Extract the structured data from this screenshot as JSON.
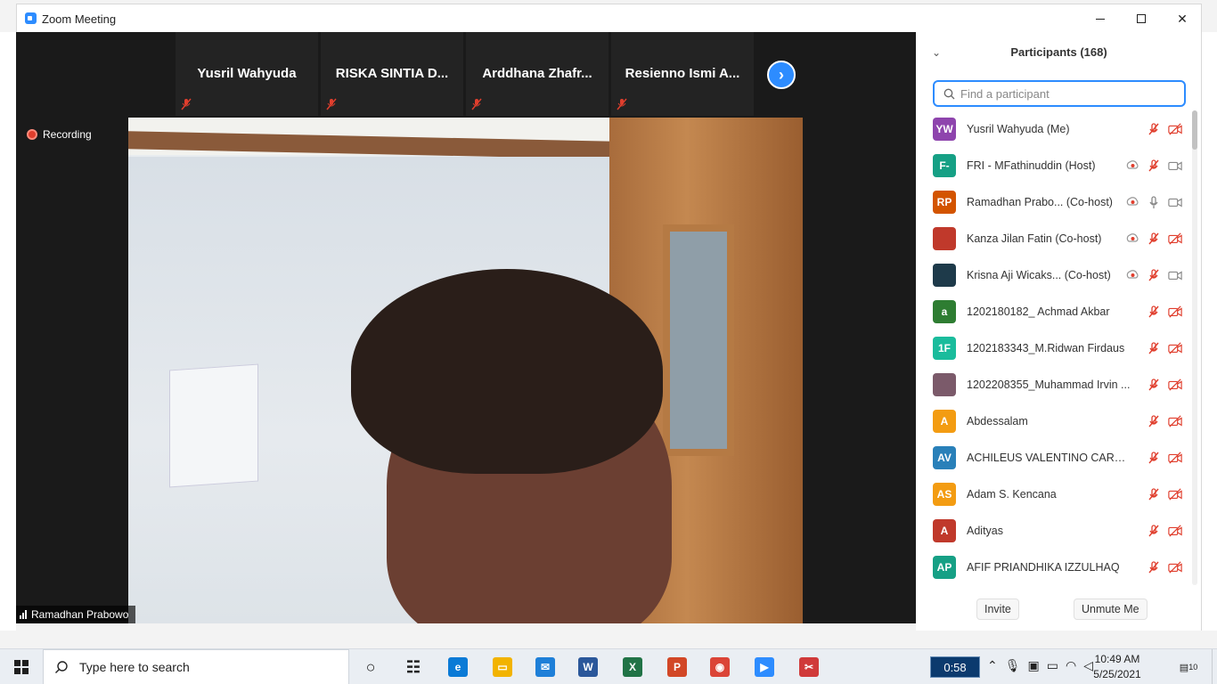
{
  "window": {
    "title": "Zoom Meeting",
    "app_icon": "zoom-icon"
  },
  "video": {
    "recording_label": "Recording",
    "thumbnails": [
      {
        "name": "Yusril Wahyuda"
      },
      {
        "name": "RISKA SINTIA D..."
      },
      {
        "name": "Arddhana Zhafr..."
      },
      {
        "name": "Resienno Ismi A..."
      }
    ],
    "speaker_name": "Ramadhan Prabowo",
    "next_arrow": "›"
  },
  "participants": {
    "title": "Participants (168)",
    "collapse_icon": "chevron-down-icon",
    "search_placeholder": "Find a participant",
    "list": [
      {
        "initials": "YW",
        "name": "Yusril Wahyuda (Me)",
        "color": "#8e44ad",
        "record": false,
        "mic": "muted",
        "video": "off"
      },
      {
        "initials": "F-",
        "name": "FRI - MFathinuddin (Host)",
        "color": "#16a085",
        "record": true,
        "mic": "muted",
        "video": "on"
      },
      {
        "initials": "RP",
        "name": "Ramadhan Prabo...  (Co-host)",
        "color": "#d35400",
        "record": true,
        "mic": "on",
        "video": "on"
      },
      {
        "initials": "",
        "name": "Kanza Jilan Fatin (Co-host)",
        "color": "#c0392b",
        "record": true,
        "mic": "muted",
        "video": "off"
      },
      {
        "initials": "",
        "name": "Krisna Aji Wicaks...  (Co-host)",
        "color": "#1e3a4a",
        "record": true,
        "mic": "muted",
        "video": "on"
      },
      {
        "initials": "a",
        "name": "1202180182_ Achmad Akbar",
        "color": "#2e7d32",
        "record": false,
        "mic": "muted",
        "video": "off"
      },
      {
        "initials": "1F",
        "name": "1202183343_M.Ridwan Firdaus",
        "color": "#1abc9c",
        "record": false,
        "mic": "muted",
        "video": "off"
      },
      {
        "initials": "",
        "name": "1202208355_Muhammad Irvin ...",
        "color": "#7b5a6a",
        "record": false,
        "mic": "muted",
        "video": "off"
      },
      {
        "initials": "A",
        "name": "Abdessalam",
        "color": "#f39c12",
        "record": false,
        "mic": "muted",
        "video": "off"
      },
      {
        "initials": "AV",
        "name": "ACHILEUS VALENTINO CARADA",
        "color": "#2980b9",
        "record": false,
        "mic": "muted",
        "video": "off"
      },
      {
        "initials": "AS",
        "name": "Adam S. Kencana",
        "color": "#f39c12",
        "record": false,
        "mic": "muted",
        "video": "off"
      },
      {
        "initials": "A",
        "name": "Adityas",
        "color": "#c0392b",
        "record": false,
        "mic": "muted",
        "video": "off"
      },
      {
        "initials": "AP",
        "name": "AFIF PRIANDHIKA IZZULHAQ",
        "color": "#16a085",
        "record": false,
        "mic": "muted",
        "video": "off"
      }
    ],
    "invite_label": "Invite",
    "unmute_label": "Unmute Me"
  },
  "taskbar": {
    "search_placeholder": "Type here to search",
    "timer": "0:58",
    "time": "10:49 AM",
    "date": "5/25/2021",
    "notifications_count": "10",
    "apps": [
      {
        "name": "task-view-icon",
        "label": "○",
        "color": "#222222"
      },
      {
        "name": "timeline-icon",
        "label": "☷",
        "color": "#222222"
      },
      {
        "name": "edge-icon",
        "label": "e",
        "color": "#0a7ad6"
      },
      {
        "name": "file-explorer-icon",
        "label": "▭",
        "color": "#f2b300"
      },
      {
        "name": "mail-icon",
        "label": "✉",
        "color": "#1e7fd8"
      },
      {
        "name": "word-icon",
        "label": "W",
        "color": "#2b579a"
      },
      {
        "name": "excel-icon",
        "label": "X",
        "color": "#217346"
      },
      {
        "name": "powerpoint-icon",
        "label": "P",
        "color": "#d24726"
      },
      {
        "name": "chrome-icon",
        "label": "◉",
        "color": "#db4437"
      },
      {
        "name": "zoom-icon",
        "label": "▶",
        "color": "#2d8cff"
      },
      {
        "name": "snipping-tool-icon",
        "label": "✂",
        "color": "#d03a3a"
      }
    ]
  }
}
